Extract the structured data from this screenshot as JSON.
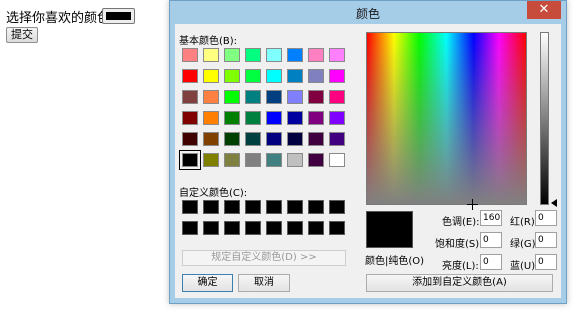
{
  "page": {
    "prompt": "选择你喜欢的颜色:",
    "submit_label": "提交"
  },
  "dialog": {
    "title": "颜色",
    "close_glyph": "✕",
    "basic_colors_label": "基本颜色(B):",
    "custom_colors_label": "自定义颜色(C):",
    "define_custom_button": "规定自定义颜色(D) >>",
    "ok_button": "确定",
    "cancel_button": "取消",
    "color_solid_label": "颜色|纯色(O)",
    "add_custom_button": "添加到自定义颜色(A)",
    "hue_label": "色调(E):",
    "sat_label": "饱和度(S):",
    "lum_label": "亮度(L):",
    "red_label": "红(R):",
    "green_label": "绿(G):",
    "blue_label": "蓝(U):",
    "hue": "160",
    "sat": "0",
    "lum": "0",
    "red": "0",
    "green": "0",
    "blue": "0",
    "selected_color": "#000000",
    "basic_colors": [
      "#ff8080",
      "#ffff80",
      "#80ff80",
      "#00ff80",
      "#80ffff",
      "#0080ff",
      "#ff80c0",
      "#ff80ff",
      "#ff0000",
      "#ffff00",
      "#80ff00",
      "#00ff40",
      "#00ffff",
      "#0080c0",
      "#8080c0",
      "#ff00ff",
      "#804040",
      "#ff8040",
      "#00ff00",
      "#008080",
      "#004080",
      "#8080ff",
      "#800040",
      "#ff0080",
      "#800000",
      "#ff8000",
      "#008000",
      "#008040",
      "#0000ff",
      "#0000a0",
      "#800080",
      "#8000ff",
      "#400000",
      "#804000",
      "#004000",
      "#004040",
      "#000080",
      "#000040",
      "#400040",
      "#400080",
      "#000000",
      "#808000",
      "#808040",
      "#808080",
      "#408080",
      "#c0c0c0",
      "#400040",
      "#ffffff"
    ],
    "custom_colors": [
      "#000000",
      "#000000",
      "#000000",
      "#000000",
      "#000000",
      "#000000",
      "#000000",
      "#000000",
      "#000000",
      "#000000",
      "#000000",
      "#000000",
      "#000000",
      "#000000",
      "#000000",
      "#000000"
    ]
  }
}
